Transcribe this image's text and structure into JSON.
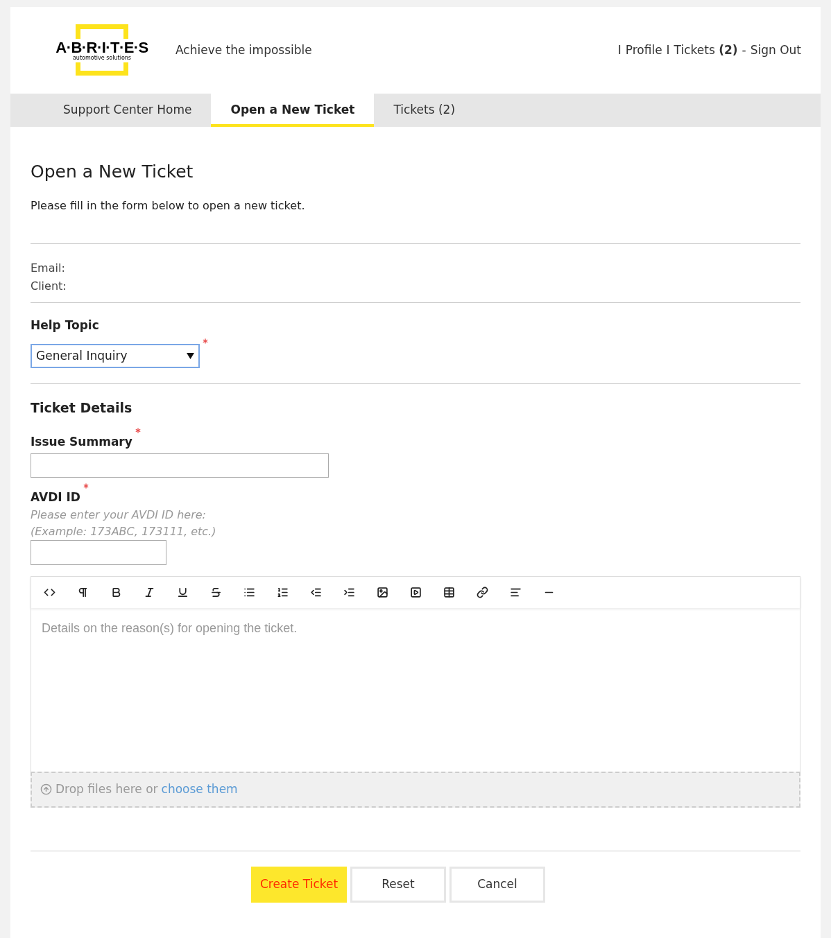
{
  "header": {
    "logo": {
      "wordmark": "A·B·R·I·T·E·S",
      "tagline": "automotive solutions"
    },
    "slogan": "Achieve the impossible",
    "links": [
      {
        "kind": "separator",
        "text": "I"
      },
      {
        "kind": "link",
        "text": "Profile"
      },
      {
        "kind": "separator",
        "text": "I"
      },
      {
        "kind": "link",
        "text": "Tickets **(2)**"
      },
      {
        "kind": "separator",
        "text": "-"
      },
      {
        "kind": "link",
        "text": "Sign Out"
      }
    ]
  },
  "tabs": [
    {
      "label": "Support Center Home",
      "selected": false
    },
    {
      "label": "Open a New Ticket",
      "selected": true
    },
    {
      "label": "Tickets (2)",
      "selected": false
    }
  ],
  "page": {
    "title": "Open a New Ticket",
    "intro": "Please fill in the form below to open a new ticket."
  },
  "user_info": [
    "Email:",
    "Client:"
  ],
  "help_topic": {
    "label": "Help Topic",
    "value": "General Inquiry",
    "required": true
  },
  "ticket_details": {
    "title": "Ticket Details",
    "issue_summary": {
      "label": "Issue Summary",
      "required": true
    },
    "avdi_id": {
      "label": "AVDI ID",
      "required": true,
      "hints": [
        "Please enter your AVDI ID here:",
        "(Example: 173ABC, 173111, etc.)"
      ]
    },
    "editor": {
      "placeholder": "Details on the reason(s) for opening the ticket."
    },
    "dropzone": {
      "text": "Drop files here or",
      "link": "choose them"
    }
  },
  "buttons": [
    {
      "label": "Create Ticket",
      "kind": "primary"
    },
    {
      "label": "Reset",
      "kind": "default"
    },
    {
      "label": "Cancel",
      "kind": "default"
    }
  ]
}
